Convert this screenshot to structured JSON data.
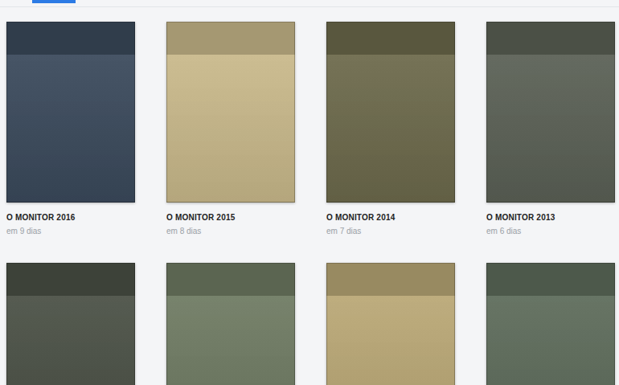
{
  "magazines": [
    {
      "title": "O MONITOR 2016",
      "date": "em 9 dias",
      "color": "#3b4a5c"
    },
    {
      "title": "O MONITOR 2015",
      "date": "em 8 dias",
      "color": "#c9b98b"
    },
    {
      "title": "O MONITOR 2014",
      "date": "em 7 dias",
      "color": "#6d6a4c"
    },
    {
      "title": "O MONITOR 2013",
      "date": "em 6 dias",
      "color": "#5b6156"
    },
    {
      "color": "#4b5146"
    },
    {
      "color": "#6f7b63"
    },
    {
      "color": "#baa876"
    },
    {
      "color": "#5e6c5b"
    }
  ]
}
